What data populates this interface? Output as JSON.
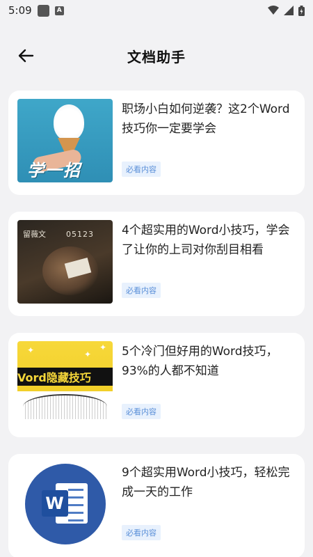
{
  "status_bar": {
    "time": "5:09"
  },
  "header": {
    "title": "文档助手"
  },
  "articles": [
    {
      "title": "职场小白如何逆袭？这2个Word技巧你一定要学会",
      "tag": "必看内容",
      "thumb_caption": "学一招"
    },
    {
      "title": "4个超实用的Word小技巧，学会了让你的上司对你刮目相看",
      "tag": "必看内容",
      "thumb_logo": "留薇文",
      "thumb_date": "05123"
    },
    {
      "title": "5个冷门但好用的Word技巧，93%的人都不知道",
      "tag": "必看内容",
      "thumb_caption": "Vord隐藏技巧"
    },
    {
      "title": "9个超实用Word小技巧，轻松完成一天的工作",
      "tag": "必看内容",
      "thumb_caption": "W"
    }
  ],
  "colors": {
    "tag_text": "#5a8fd8",
    "tag_bg": "#e8f1fd",
    "card_bg": "#ffffff",
    "page_bg": "#f2f2f4"
  }
}
